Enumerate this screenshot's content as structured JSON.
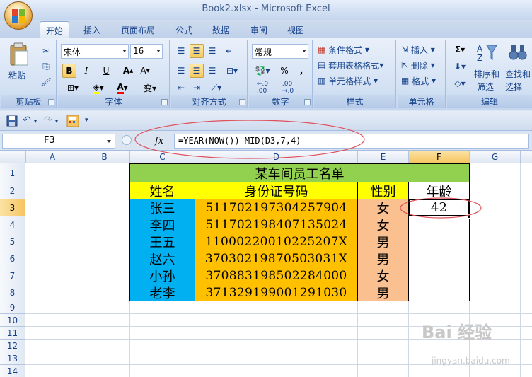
{
  "window": {
    "title": "Book2.xlsx - Microsoft Excel"
  },
  "tabs": [
    "开始",
    "插入",
    "页面布局",
    "公式",
    "数据",
    "审阅",
    "视图"
  ],
  "ribbon": {
    "clipboard": {
      "paste": "粘贴",
      "label": "剪贴板"
    },
    "font": {
      "name": "宋体",
      "size": "16",
      "label": "字体",
      "bold": "B",
      "italic": "I",
      "underline": "U"
    },
    "alignment": {
      "label": "对齐方式"
    },
    "number": {
      "format": "常规",
      "label": "数字",
      "percent": "%",
      "comma": ","
    },
    "styles": {
      "conditional": "条件格式",
      "table": "套用表格格式",
      "cell_styles": "单元格样式",
      "label": "样式"
    },
    "cells": {
      "insert": "插入",
      "delete": "删除",
      "format": "格式",
      "label": "单元格"
    },
    "editing": {
      "sum": "Σ",
      "sort": "排序和",
      "sort2": "筛选",
      "find": "查找和",
      "find2": "选择",
      "label": "编辑"
    }
  },
  "formula_bar": {
    "cell_ref": "F3",
    "fx": "fx",
    "formula": "=YEAR(NOW())-MID(D3,7,4)"
  },
  "columns": [
    "A",
    "B",
    "C",
    "D",
    "E",
    "F",
    "G"
  ],
  "rows": [
    "1",
    "2",
    "3",
    "4",
    "5",
    "6",
    "7",
    "8",
    "9",
    "10",
    "11",
    "12",
    "13",
    "14"
  ],
  "sheet": {
    "title": "某车间员工名单",
    "headers": [
      "姓名",
      "身份证号码",
      "性别",
      "年龄"
    ],
    "records": [
      {
        "name": "张三",
        "id": "511702197304257904",
        "gender": "女",
        "age": "42"
      },
      {
        "name": "李四",
        "id": "511702198407135024",
        "gender": "女",
        "age": ""
      },
      {
        "name": "王五",
        "id": "11000220010225207X",
        "gender": "男",
        "age": ""
      },
      {
        "name": "赵六",
        "id": "37030219870503031X",
        "gender": "男",
        "age": ""
      },
      {
        "name": "小孙",
        "id": "370883198502284000",
        "gender": "女",
        "age": ""
      },
      {
        "name": "老李",
        "id": "371329199001291030",
        "gender": "男",
        "age": ""
      }
    ]
  },
  "colors": {
    "title_bg": "#92d050",
    "header_bg": "#ffff00",
    "name_bg": "#00b0f0",
    "id_bg": "#ffc000",
    "gender_bg": "#fac090",
    "annotation": "#e0505a"
  },
  "watermark": {
    "text": "Bai 经验",
    "url": "jingyan.baidu.com"
  }
}
